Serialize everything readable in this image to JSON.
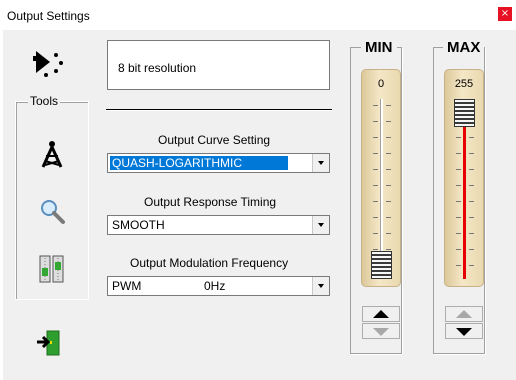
{
  "window": {
    "title": "Output Settings",
    "close_glyph": "×"
  },
  "status": {
    "text": "8 bit resolution",
    "icon": "resolution-dots-icon"
  },
  "tools": {
    "legend": "Tools",
    "items": [
      {
        "name": "signal-tower-icon"
      },
      {
        "name": "magnifier-icon"
      },
      {
        "name": "sliders-icon"
      }
    ]
  },
  "exit": {
    "icon": "exit-door-icon"
  },
  "fields": {
    "curve": {
      "label": "Output Curve Setting",
      "value": "QUASH-LOGARITHMIC"
    },
    "timing": {
      "label": "Output Response Timing",
      "value": "SMOOTH"
    },
    "frequency": {
      "label": "Output Modulation Frequency",
      "value": "PWM",
      "extra": "0Hz"
    }
  },
  "min": {
    "label": "MIN",
    "value": "0",
    "level": 0
  },
  "max": {
    "label": "MAX",
    "value": "255",
    "level": 255
  },
  "range": {
    "min": 0,
    "max": 255
  },
  "colors": {
    "accent": "#0078d7",
    "max_fill": "#e60000",
    "close": "#e81123",
    "slider_panel": "#f4e7c6"
  }
}
